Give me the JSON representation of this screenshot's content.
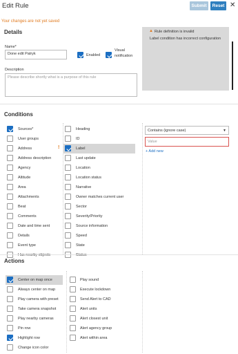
{
  "header": {
    "title": "Edit Rule",
    "submit_label": "Submit",
    "reset_label": "Reset",
    "close_glyph": "✕"
  },
  "warning_text": "Your changes are not yet saved",
  "details": {
    "section_title": "Details",
    "name_label": "Name*",
    "name_value": "Done edit Patryk",
    "enabled_label": "Enabled",
    "visual_notification_line1": "Visual",
    "visual_notification_line2": "notification",
    "description_label": "Description",
    "description_placeholder": "Please describe shortly what is a purpose of this rule"
  },
  "info_box": {
    "title": "Rule definition is invalid",
    "message": "Label condition has incorrect configuration",
    "icon": "warning-icon"
  },
  "conditions": {
    "section_title": "Conditions",
    "column1": [
      {
        "label": "Sources*",
        "checked": true
      },
      {
        "label": "User groups",
        "checked": false
      },
      {
        "label": "Address",
        "checked": false
      },
      {
        "label": "Address description",
        "checked": false
      },
      {
        "label": "Agency",
        "checked": false
      },
      {
        "label": "Altitude",
        "checked": false
      },
      {
        "label": "Area",
        "checked": false
      },
      {
        "label": "Attachments",
        "checked": false
      },
      {
        "label": "Beat",
        "checked": false
      },
      {
        "label": "Comments",
        "checked": false
      },
      {
        "label": "Date and time sent",
        "checked": false
      },
      {
        "label": "Details",
        "checked": false
      },
      {
        "label": "Event type",
        "checked": false
      },
      {
        "label": "Has nearby objects",
        "checked": false
      }
    ],
    "column2": [
      {
        "label": "Heading",
        "checked": false
      },
      {
        "label": "ID",
        "checked": false
      },
      {
        "label": "Label",
        "checked": true
      },
      {
        "label": "Last update",
        "checked": false
      },
      {
        "label": "Location",
        "checked": false
      },
      {
        "label": "Location status",
        "checked": false
      },
      {
        "label": "Narrative",
        "checked": false
      },
      {
        "label": "Owner matches current user",
        "checked": false
      },
      {
        "label": "Sector",
        "checked": false
      },
      {
        "label": "Severity/Priority",
        "checked": false
      },
      {
        "label": "Source information",
        "checked": false
      },
      {
        "label": "Speed",
        "checked": false
      },
      {
        "label": "State",
        "checked": false
      },
      {
        "label": "Status",
        "checked": false
      }
    ],
    "operator_select": "Contains (ignore case)",
    "value_placeholder": "Value",
    "add_new_label": "+ Add new",
    "warning_mark": "!"
  },
  "actions": {
    "section_title": "Actions",
    "column1": [
      {
        "label": "Center on map once",
        "checked": true
      },
      {
        "label": "Always center on map",
        "checked": false
      },
      {
        "label": "Play camera with preset",
        "checked": false
      },
      {
        "label": "Take camera snapshot",
        "checked": false
      },
      {
        "label": "Play nearby cameras",
        "checked": false
      },
      {
        "label": "Pin row",
        "checked": false
      },
      {
        "label": "Highlight row",
        "checked": true
      },
      {
        "label": "Change icon color",
        "checked": false
      }
    ],
    "column2": [
      {
        "label": "Play sound",
        "checked": false
      },
      {
        "label": "Execute lockdown",
        "checked": false
      },
      {
        "label": "Send Alert to CAD",
        "checked": false
      },
      {
        "label": "Alert units",
        "checked": false
      },
      {
        "label": "Alert closest unit",
        "checked": false
      },
      {
        "label": "Alert agency group",
        "checked": false
      },
      {
        "label": "Alert within area",
        "checked": false
      }
    ]
  },
  "colors": {
    "accent": "#1b6ec2",
    "warning": "#e07a1f",
    "error_border": "#d9534f",
    "submit_disabled": "#a9c6dc",
    "reset": "#2f7fbf"
  }
}
